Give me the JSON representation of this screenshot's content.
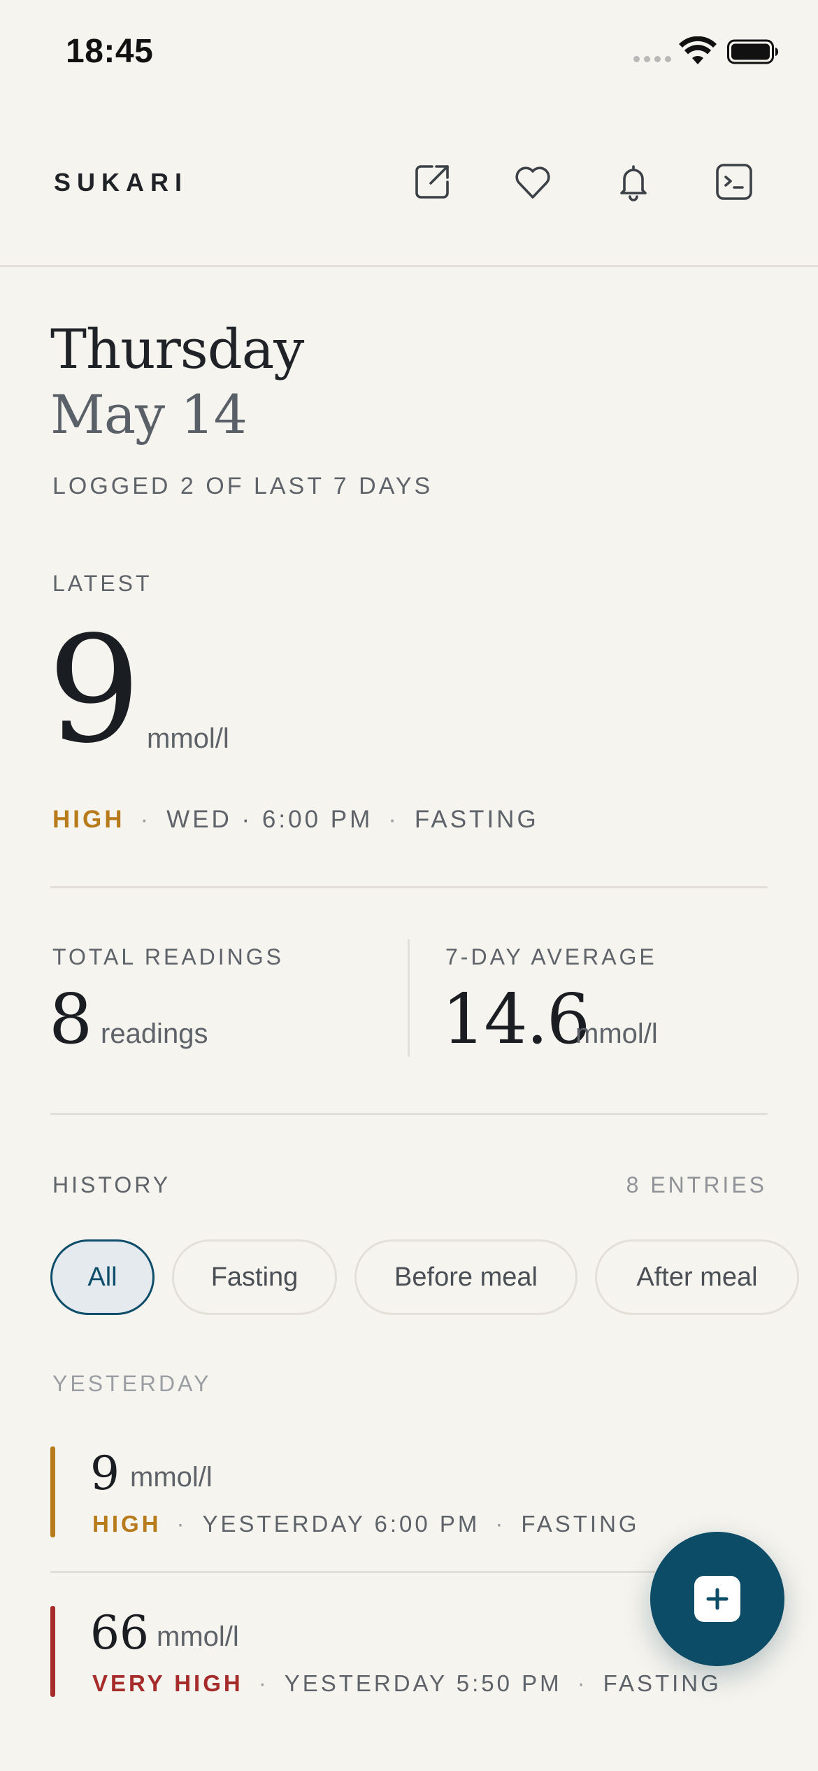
{
  "status_bar": {
    "time": "18:45"
  },
  "header": {
    "brand": "SUKARI",
    "icons": [
      "share-icon",
      "heart-icon",
      "bell-icon",
      "terminal-icon"
    ]
  },
  "date": {
    "weekday": "Thursday",
    "date": "May 14",
    "logged": "LOGGED 2 OF LAST 7 DAYS"
  },
  "latest": {
    "label": "LATEST",
    "value": "9",
    "unit": "mmol/l",
    "level": "HIGH",
    "day_time": "WED · 6:00 PM",
    "context": "FASTING",
    "level_color": "#b87b1c"
  },
  "stats": {
    "total_label": "TOTAL READINGS",
    "total_value": "8",
    "total_unit": "readings",
    "avg_label": "7-DAY AVERAGE",
    "avg_value": "14.6",
    "avg_unit": "mmol/l"
  },
  "history": {
    "label": "HISTORY",
    "count": "8 ENTRIES",
    "filters": [
      "All",
      "Fasting",
      "Before meal",
      "After meal"
    ],
    "active_filter": "All",
    "group_label": "YESTERDAY",
    "entries": [
      {
        "value": "9",
        "unit": "mmol/l",
        "level": "HIGH",
        "time": "YESTERDAY 6:00 PM",
        "context": "FASTING",
        "color": "#b87b1c"
      },
      {
        "value": "66",
        "unit": "mmol/l",
        "level": "VERY HIGH",
        "time": "YESTERDAY 5:50 PM",
        "context": "FASTING",
        "color": "#a62b2b"
      }
    ]
  },
  "colors": {
    "accent": "#0c4c67",
    "background": "#f6f4ef"
  },
  "fab": {
    "icon": "plus-square-icon"
  }
}
